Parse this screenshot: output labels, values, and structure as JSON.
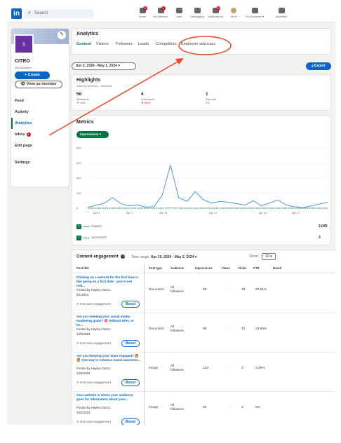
{
  "topbar": {
    "logo": "in",
    "search_placeholder": "Search",
    "nav": [
      {
        "label": "Home",
        "icon": "home-icon",
        "badge": "5"
      },
      {
        "label": "My Network",
        "icon": "network-icon",
        "badge": "1"
      },
      {
        "label": "Jobs",
        "icon": "briefcase-icon",
        "badge": ""
      },
      {
        "label": "Messaging",
        "icon": "message-icon",
        "badge": ""
      },
      {
        "label": "Notifications",
        "icon": "bell-icon",
        "badge": "11"
      },
      {
        "label": "Me ▾",
        "icon": "avatar-icon",
        "badge": ""
      },
      {
        "label": "For Business ▾",
        "icon": "grid-icon",
        "badge": ""
      },
      {
        "label": "Advertise",
        "icon": "advertise-icon",
        "badge": ""
      }
    ]
  },
  "sidebar": {
    "org_name": "CITRO",
    "followers": "356 followers",
    "create_label": "+ Create",
    "view_member_label": "👁 View as member",
    "items": [
      {
        "label": "Feed",
        "active": false
      },
      {
        "label": "Activity",
        "active": false
      },
      {
        "label": "Analytics",
        "active": true
      },
      {
        "label": "Inbox",
        "active": false,
        "badge": "1"
      },
      {
        "label": "Edit page",
        "active": false
      },
      {
        "label": "Settings",
        "active": false
      }
    ]
  },
  "analytics": {
    "title": "Analytics",
    "tabs": [
      "Content",
      "Visitors",
      "Followers",
      "Leads",
      "Competitors",
      "Employee advocacy"
    ],
    "active_tab": "Content"
  },
  "toolbar": {
    "date_range": "Apr 2, 2024 - May 1, 2024 ▾",
    "export_label": "⤓ Export"
  },
  "highlights": {
    "title": "Highlights",
    "subtitle": "Data for 4/2/2024 - 5/1/2024",
    "stats": [
      {
        "value": "56",
        "label": "Reactions",
        "change": "▼ 15%",
        "color": "#666666"
      },
      {
        "value": "4",
        "label": "Comments",
        "change": "▼ 80%",
        "color": "#cb112d"
      },
      {
        "value": "1",
        "label": "Reposts",
        "change": "0%",
        "color": "#666666"
      }
    ]
  },
  "metrics": {
    "title": "Metrics",
    "selector": "Impressions ▾",
    "legend": [
      {
        "label": "Organic",
        "value": "2,045",
        "color": "#378fe9",
        "dashed": false
      },
      {
        "label": "Sponsored",
        "value": "3",
        "color": "#057642",
        "dashed": true
      }
    ]
  },
  "chart_data": {
    "type": "line",
    "y_ticks": [
      "800",
      "600",
      "400",
      "200",
      "0"
    ],
    "ylim": [
      0,
      800
    ],
    "x_ticks": [
      "Apr 3",
      "Apr 7",
      "Apr 11",
      "Apr 17",
      "Apr 23",
      "Apr 27"
    ],
    "series": [
      {
        "name": "Organic",
        "color": "#378fe9",
        "values": [
          10,
          40,
          65,
          140,
          60,
          30,
          45,
          15,
          20,
          170,
          570,
          140,
          90,
          220,
          110,
          70,
          90,
          80,
          60,
          40,
          100,
          30,
          70,
          110,
          40,
          20,
          5,
          30,
          55,
          80
        ]
      },
      {
        "name": "Sponsored",
        "color": "#057642",
        "values": [
          0,
          0,
          0,
          0,
          0,
          0,
          0,
          0,
          0,
          0,
          3,
          0,
          0,
          0,
          0,
          0,
          0,
          0,
          0,
          0,
          0,
          0,
          0,
          0,
          0,
          0,
          0,
          0,
          0,
          0
        ]
      }
    ]
  },
  "content_engagement": {
    "title": "Content engagement",
    "time_range_label": "Time range:",
    "time_range_value": "Apr 19, 2024 - May 2, 2024 ▾",
    "show_label": "Show:",
    "show_value": "10 ▾",
    "headers": [
      "Post title",
      "Post type",
      "Audience",
      "Impressions",
      "Views",
      "Clicks",
      "CTR",
      "Reacti"
    ],
    "boost_label": "Boost",
    "engage_label": "✳ Get more engagement",
    "rows": [
      {
        "title": "Clicking on a website for the first time is like going on a first date - you're not real...",
        "by": "Posted by Hayley Gazzo",
        "date": "5/1/2024",
        "type": "Document",
        "audience": "All followers",
        "impressions": "59",
        "views": "-",
        "clicks": "18",
        "ctr": "30.51%"
      },
      {
        "title": "Are you meeting your social media marketing goals? 🎯 Without KPIs, or ke...",
        "by": "Posted by Hayley Gazzo",
        "date": "4/29/2024",
        "type": "Document",
        "audience": "All followers",
        "impressions": "95",
        "views": "-",
        "clicks": "22",
        "ctr": "23.66%"
      },
      {
        "title": "Are you keeping your team engaged? 🙋 🙋 One way to enhance brand awarenes...",
        "by": "Posted by Hayley Gazzo",
        "date": "4/24/2024",
        "type": "Image",
        "audience": "All followers",
        "impressions": "133",
        "views": "-",
        "clicks": "3",
        "ctr": "2.26%"
      },
      {
        "title": "Your website is where your audience goes for information about your...",
        "by": "Posted by Hayley Gazzo",
        "date": "4/22/2024",
        "type": "Image",
        "audience": "All followers",
        "impressions": "60",
        "views": "-",
        "clicks": "3",
        "ctr": "5%"
      }
    ]
  },
  "annotation": {
    "arrow_color": "#e8482b",
    "circle_color": "#e8482b"
  }
}
